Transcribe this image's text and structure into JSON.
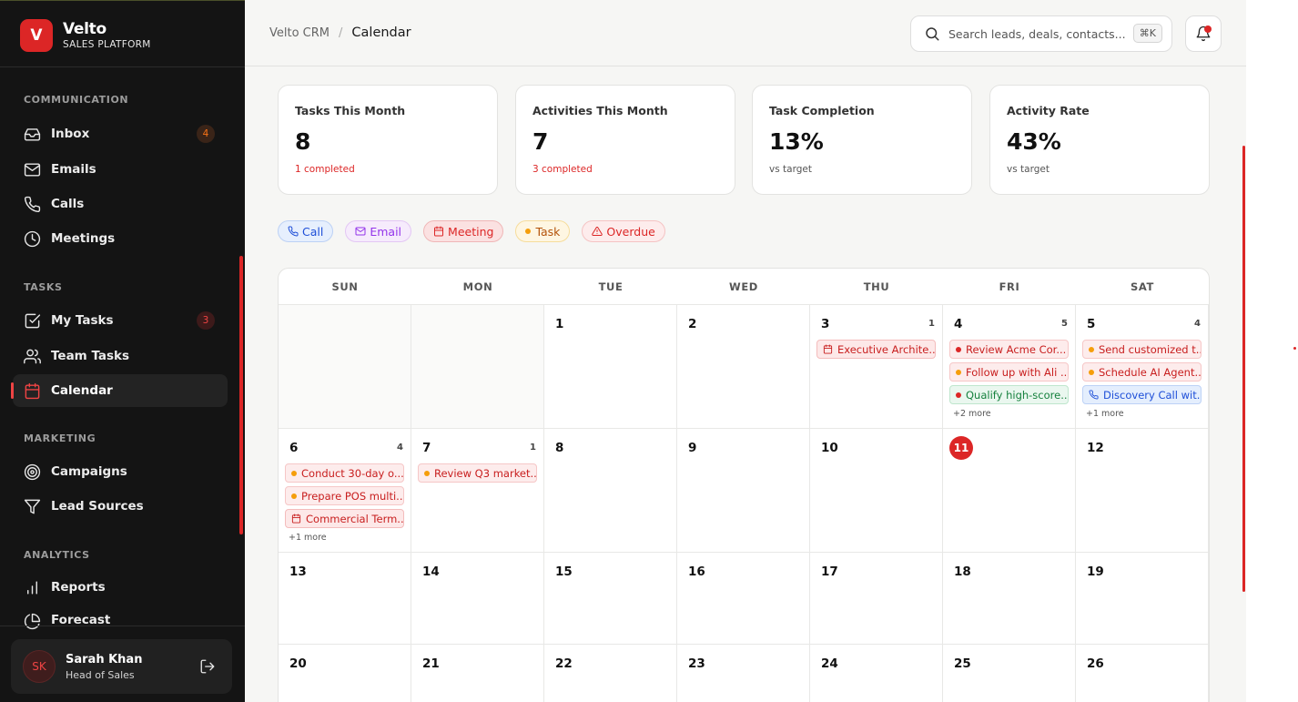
{
  "brand": {
    "logo": "V",
    "name": "Velto",
    "subtitle": "SALES PLATFORM"
  },
  "nav": {
    "communication": {
      "title": "COMMUNICATION",
      "items": [
        {
          "label": "Inbox",
          "icon": "inbox-icon",
          "badge": "4"
        },
        {
          "label": "Emails",
          "icon": "mail-icon"
        },
        {
          "label": "Calls",
          "icon": "phone-icon"
        },
        {
          "label": "Meetings",
          "icon": "clock-icon"
        }
      ]
    },
    "tasks": {
      "title": "TASKS",
      "items": [
        {
          "label": "My Tasks",
          "icon": "check-square-icon",
          "badge": "3"
        },
        {
          "label": "Team Tasks",
          "icon": "users-icon"
        },
        {
          "label": "Calendar",
          "icon": "calendar-icon",
          "active": true
        }
      ]
    },
    "marketing": {
      "title": "MARKETING",
      "items": [
        {
          "label": "Campaigns",
          "icon": "target-icon"
        },
        {
          "label": "Lead Sources",
          "icon": "filter-icon"
        }
      ]
    },
    "analytics": {
      "title": "ANALYTICS",
      "items": [
        {
          "label": "Reports",
          "icon": "bar-chart-icon"
        },
        {
          "label": "Forecast",
          "icon": "pie-chart-icon"
        }
      ]
    }
  },
  "user": {
    "initials": "SK",
    "name": "Sarah Khan",
    "role": "Head of Sales"
  },
  "header": {
    "crumb_root": "Velto CRM",
    "crumb_sep": "/",
    "crumb_current": "Calendar",
    "search_placeholder": "Search leads, deals, contacts...",
    "search_shortcut": "⌘K"
  },
  "stats": [
    {
      "label": "Tasks This Month",
      "value": "8",
      "sub": "1 completed"
    },
    {
      "label": "Activities This Month",
      "value": "7",
      "sub": "3 completed"
    },
    {
      "label": "Task Completion",
      "value": "13%",
      "sub": "vs target"
    },
    {
      "label": "Activity Rate",
      "value": "43%",
      "sub": "vs target"
    }
  ],
  "legend": [
    "Call",
    "Email",
    "Meeting",
    "Task",
    "Overdue"
  ],
  "colors": {
    "accent": "#dc2626",
    "call": "#1d4ed8",
    "email": "#9333ea",
    "meeting": "#dc2626",
    "task": "#f59e0b",
    "overdue": "#dc2626"
  },
  "calendar": {
    "weekdays": [
      "SUN",
      "MON",
      "TUE",
      "WED",
      "THU",
      "FRI",
      "SAT"
    ],
    "today": "11",
    "weeks": [
      [
        {
          "day": ""
        },
        {
          "day": ""
        },
        {
          "day": "1"
        },
        {
          "day": "2"
        },
        {
          "day": "3",
          "count": "1",
          "events": [
            {
              "type": "meeting",
              "text": "Executive Archite..."
            }
          ]
        },
        {
          "day": "4",
          "count": "5",
          "events": [
            {
              "type": "task-red",
              "text": "Review Acme Cor..."
            },
            {
              "type": "task-amber",
              "text": "Follow up with Ali ..."
            },
            {
              "type": "task-green",
              "text": "Qualify high-score..."
            }
          ],
          "more": "+2 more"
        },
        {
          "day": "5",
          "count": "4",
          "events": [
            {
              "type": "task-amber",
              "text": "Send customized t..."
            },
            {
              "type": "task-amber",
              "text": "Schedule AI Agent..."
            },
            {
              "type": "call",
              "text": "Discovery Call wit..."
            }
          ],
          "more": "+1 more"
        }
      ],
      [
        {
          "day": "6",
          "count": "4",
          "events": [
            {
              "type": "task-amber",
              "text": "Conduct 30-day o..."
            },
            {
              "type": "task-amber",
              "text": "Prepare POS multi..."
            },
            {
              "type": "meeting",
              "text": "Commercial Term..."
            }
          ],
          "more": "+1 more"
        },
        {
          "day": "7",
          "count": "1",
          "events": [
            {
              "type": "task-amber",
              "text": "Review Q3 market..."
            }
          ]
        },
        {
          "day": "8"
        },
        {
          "day": "9"
        },
        {
          "day": "10"
        },
        {
          "day": "11"
        },
        {
          "day": "12"
        }
      ],
      [
        {
          "day": "13"
        },
        {
          "day": "14"
        },
        {
          "day": "15"
        },
        {
          "day": "16"
        },
        {
          "day": "17"
        },
        {
          "day": "18"
        },
        {
          "day": "19"
        }
      ],
      [
        {
          "day": "20"
        },
        {
          "day": "21"
        },
        {
          "day": "22"
        },
        {
          "day": "23"
        },
        {
          "day": "24"
        },
        {
          "day": "25"
        },
        {
          "day": "26"
        }
      ]
    ]
  }
}
